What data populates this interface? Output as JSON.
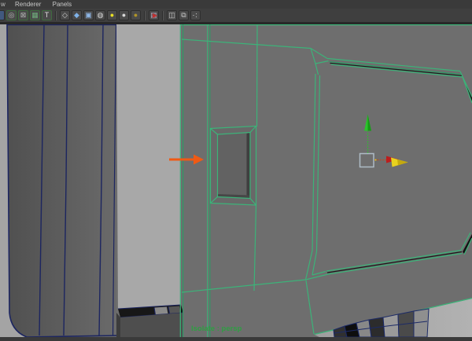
{
  "menu_bar": {
    "partial_item": "w",
    "items": [
      {
        "label": "Renderer"
      },
      {
        "label": "Panels"
      }
    ]
  },
  "toolbar": {
    "icons": [
      {
        "name": "partial-icon",
        "glyph": "",
        "color": "#6f87ab"
      },
      {
        "name": "resolution-gate-icon",
        "glyph": "◎",
        "color": "#bfbfbf"
      },
      {
        "name": "gate-mask-icon",
        "glyph": "⊠",
        "color": "#b5b5b5"
      },
      {
        "name": "field-chart-icon",
        "glyph": "▦",
        "color": "#6fae7c"
      },
      {
        "name": "safe-title-icon",
        "glyph": "T",
        "color": "#dddddd"
      },
      {
        "name": "wireframe-mode-icon",
        "glyph": "◇",
        "color": "#cfcfcf"
      },
      {
        "name": "smooth-shade-icon",
        "glyph": "◆",
        "color": "#7fb2e8"
      },
      {
        "name": "textured-mode-icon",
        "glyph": "▣",
        "color": "#8fb8e8"
      },
      {
        "name": "default-material-icon",
        "glyph": "◍",
        "color": "#d8d8d8"
      },
      {
        "name": "all-lights-icon",
        "glyph": "●",
        "color": "#e8df25"
      },
      {
        "name": "default-light-icon",
        "glyph": "●",
        "color": "#d6d6d6"
      },
      {
        "name": "no-lights-icon",
        "glyph": "●",
        "color": "#b09427"
      },
      {
        "name": "isolate-select-icon",
        "glyph": "▤",
        "color": "#b9a9bc"
      },
      {
        "name": "xray-icon",
        "glyph": "◫",
        "color": "#c6c6c6"
      },
      {
        "name": "xray-components-icon",
        "glyph": "⧉",
        "color": "#c6c6c6"
      },
      {
        "name": "display-filters-icon",
        "glyph": "∴",
        "color": "#cccccc"
      }
    ]
  },
  "viewport": {
    "isolate_label": "Isolate : persp",
    "camera_name": "persp",
    "mode": "isolate-select"
  },
  "manipulator": {
    "tool": "move"
  },
  "colors": {
    "selected_wireframe": "#3cb379",
    "unselected_wireframe": "#1c2560",
    "object_fill": "#6e6e6e",
    "left_panel_fill": "#585858",
    "light_strip_fill": "#a8a8a8",
    "annotation_arrow": "#f05a14",
    "manipulator_y_axis": "#2bc42b",
    "manipulator_x_axis": "#bb1e1e",
    "manipulator_active_axis": "#e8d21e",
    "isolate_text": "#2f9e43"
  }
}
